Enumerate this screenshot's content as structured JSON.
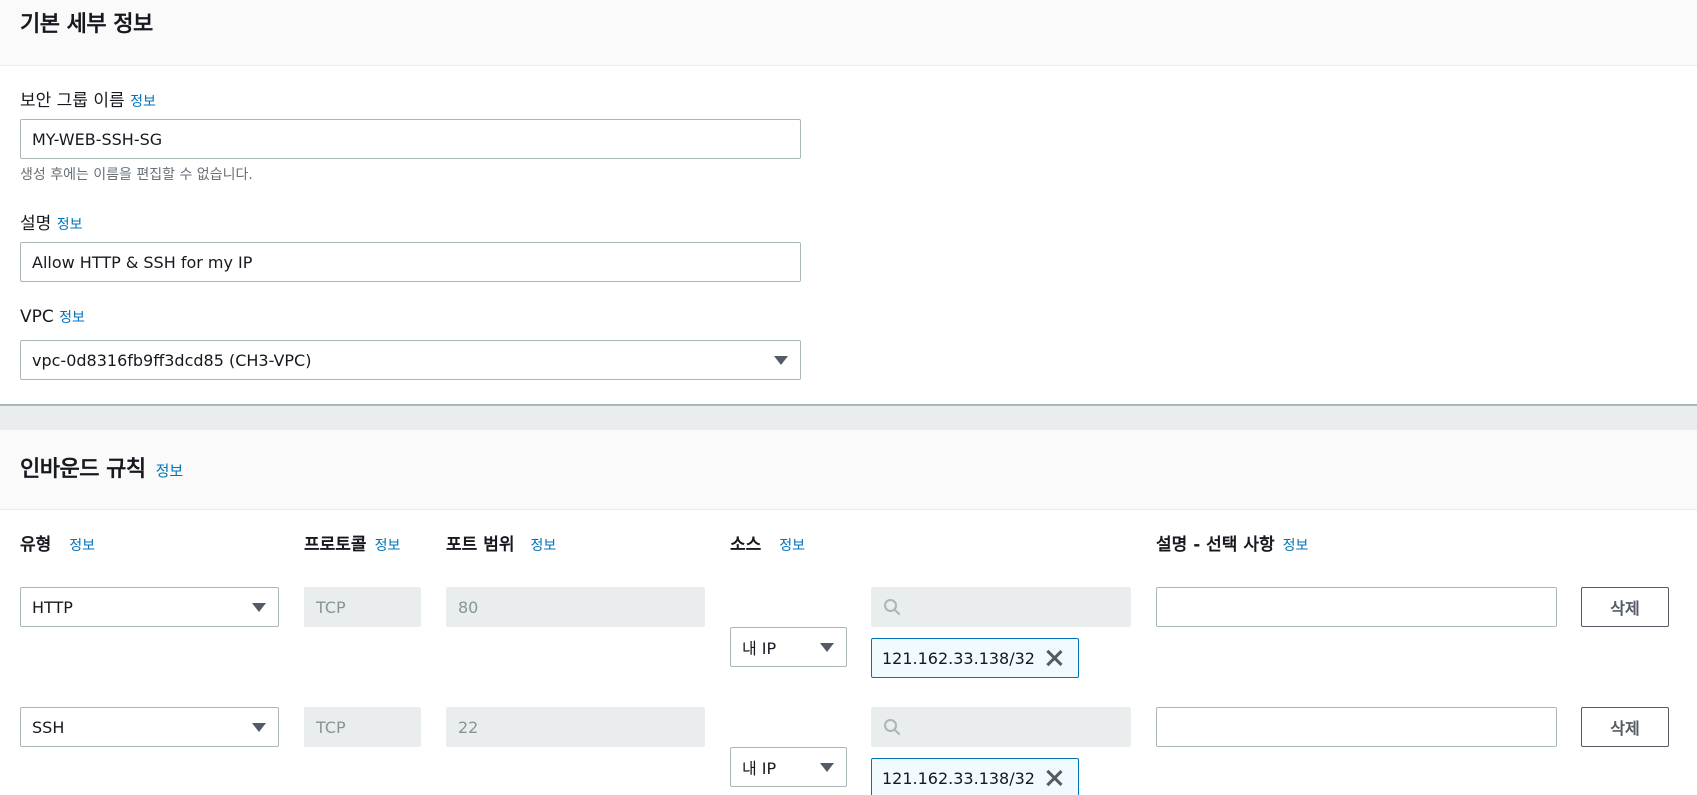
{
  "basic": {
    "title": "기본 세부 정보",
    "name_label": "보안 그룹 이름",
    "name_info": "정보",
    "name_value": "MY-WEB-SSH-SG",
    "name_hint": "생성 후에는 이름을 편집할 수 없습니다.",
    "desc_label": "설명",
    "desc_info": "정보",
    "desc_value": "Allow HTTP & SSH for my IP",
    "vpc_label": "VPC",
    "vpc_info": "정보",
    "vpc_value": "vpc-0d8316fb9ff3dcd85 (CH3-VPC)"
  },
  "inbound": {
    "title": "인바운드 규칙",
    "title_info": "정보",
    "columns": {
      "type": "유형",
      "type_info": "정보",
      "protocol": "프로토콜",
      "protocol_info": "정보",
      "port": "포트 범위",
      "port_info": "정보",
      "source": "소스",
      "source_info": "정보",
      "description": "설명 - 선택 사항",
      "description_info": "정보"
    },
    "rows": [
      {
        "type": "HTTP",
        "protocol": "TCP",
        "port": "80",
        "source": "내 IP",
        "search_value": "",
        "cidr": "121.162.33.138/32",
        "description": "",
        "delete_label": "삭제"
      },
      {
        "type": "SSH",
        "protocol": "TCP",
        "port": "22",
        "source": "내 IP",
        "search_value": "",
        "cidr": "121.162.33.138/32",
        "description": "",
        "delete_label": "삭제"
      }
    ]
  },
  "icons": {
    "dropdown": "caret-down-icon",
    "search": "search-icon",
    "remove": "close-icon"
  },
  "colors": {
    "link": "#0073bb",
    "token_border": "#0073bb",
    "disabled_bg": "#eaeded"
  }
}
